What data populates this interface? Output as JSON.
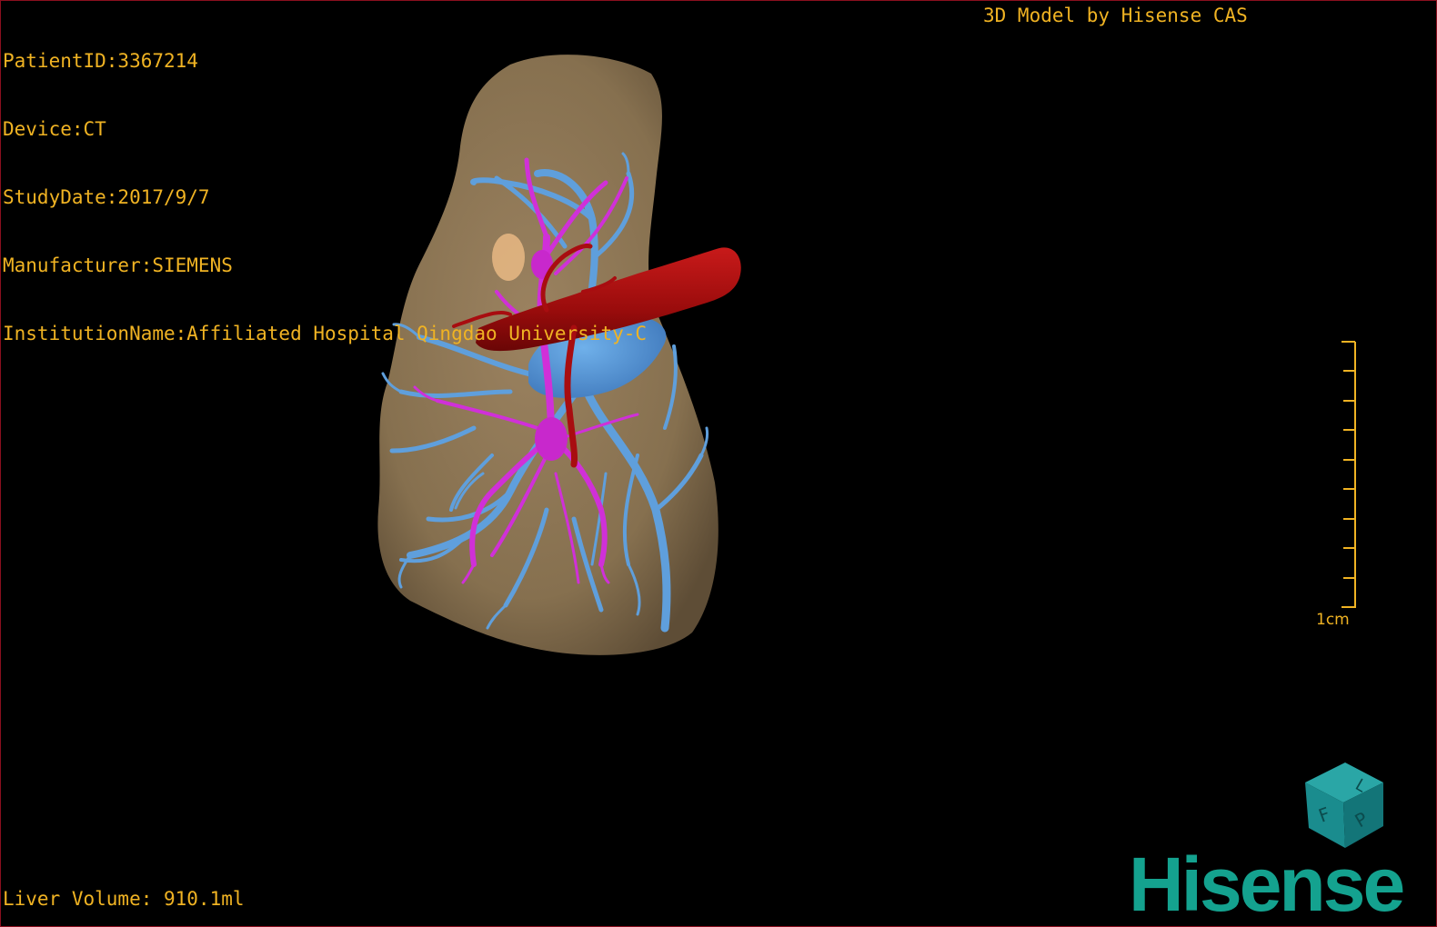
{
  "patient": {
    "id_line": "PatientID:3367214",
    "device_line": "Device:CT",
    "study_date_line": "StudyDate:2017/9/7",
    "manufacturer_line": "Manufacturer:SIEMENS",
    "institution_line": "InstitutionName:Affiliated Hospital Qingdao University-C"
  },
  "credit": "3D Model by Hisense CAS",
  "volume": "Liver Volume: 910.1ml",
  "scale_bar": {
    "label": "1cm"
  },
  "orientation_cube": {
    "face_front": "F",
    "face_side": "P",
    "face_top": "L"
  },
  "brand": {
    "logo_text": "Hisense",
    "color": "#14a28f"
  },
  "colors": {
    "overlay_text": "#f0b323",
    "liver": "#8b7352",
    "portal_vein": "#5f9fdc",
    "hepatic_vein": "#d030d8",
    "artery": "#a80d10"
  }
}
